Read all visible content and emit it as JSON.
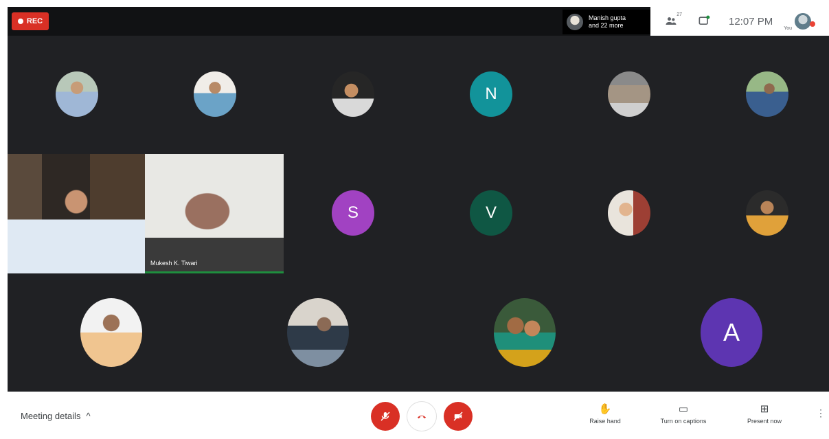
{
  "recording": {
    "label": "REC"
  },
  "presenter": {
    "line1": "Manish gupta",
    "line2": "and 22 more"
  },
  "topbar_right": {
    "people_count": "27",
    "time": "12:07 PM",
    "you_label": "You"
  },
  "participants_letters": [
    "N",
    "S",
    "V",
    "A"
  ],
  "video_tiles": {
    "active_speaker_name": "Mukesh K. Tiwari"
  },
  "bottom": {
    "meeting_details": "Meeting details",
    "raise_hand": "Raise hand",
    "captions": "Turn on captions",
    "present": "Present now"
  }
}
